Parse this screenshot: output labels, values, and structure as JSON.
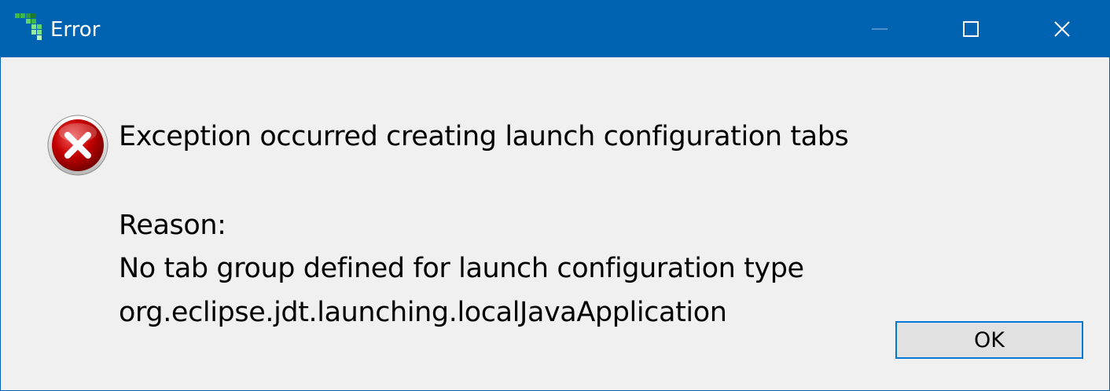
{
  "window": {
    "title": "Error",
    "app_icon": "eclipse-installer-icon",
    "controls": {
      "minimize": "minimize-icon",
      "maximize": "maximize-icon",
      "close": "close-icon"
    }
  },
  "dialog": {
    "icon": "error-icon",
    "message": "Exception occurred creating launch configuration tabs",
    "reason_label": "Reason:",
    "reason_detail": "No tab group defined for launch configuration type",
    "reason_type": "org.eclipse.jdt.launching.localJavaApplication",
    "ok_label": "OK"
  },
  "colors": {
    "titlebar": "#0063b1",
    "background": "#f0f0f0",
    "button_border": "#0078d7",
    "button_face": "#e1e1e1",
    "error_red": "#c40000"
  }
}
